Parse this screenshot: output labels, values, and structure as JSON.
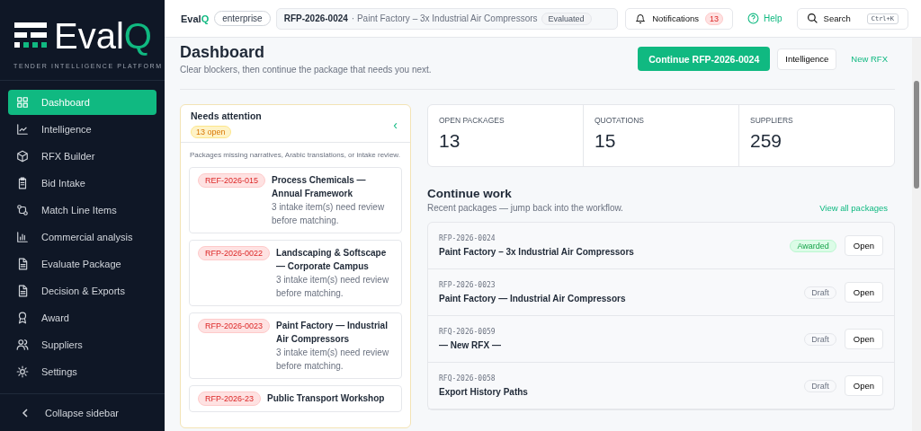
{
  "sidebar": {
    "logo": {
      "text": "Eval",
      "accent": "Q"
    },
    "tagline": "TENDER INTELLIGENCE PLATFORM",
    "items": [
      {
        "label": "Dashboard",
        "selected": true
      },
      {
        "label": "Intelligence",
        "selected": false
      },
      {
        "label": "RFX Builder",
        "selected": false
      },
      {
        "label": "Bid Intake",
        "selected": false
      },
      {
        "label": "Match Line Items",
        "selected": false
      },
      {
        "label": "Commercial analysis",
        "selected": false
      },
      {
        "label": "Evaluate Package",
        "selected": false
      },
      {
        "label": "Decision & Exports",
        "selected": false
      },
      {
        "label": "Award",
        "selected": false
      },
      {
        "label": "Suppliers",
        "selected": false
      },
      {
        "label": "Settings",
        "selected": false
      }
    ],
    "collapse": "Collapse sidebar"
  },
  "topbar": {
    "brand": {
      "text": "Eval",
      "accent": "Q"
    },
    "plan": "enterprise",
    "context": {
      "id": "RFP-2026-0024",
      "title": "· Paint Factory – 3x Industrial Air Compressors",
      "status": "Evaluated"
    },
    "notifications": {
      "label": "Notifications",
      "count": "13"
    },
    "help": "Help",
    "search": {
      "label": "Search",
      "shortcut": "Ctrl+K"
    }
  },
  "header": {
    "title": "Dashboard",
    "subtitle": "Clear blockers, then continue the package that needs you next.",
    "primary": "Continue RFP-2026-0024",
    "secondary": "Intelligence",
    "link": "New RFX"
  },
  "attention": {
    "title": "Needs attention",
    "badge": "13 open",
    "collapse": "‹",
    "note": "Packages missing narratives, Arabic translations, or intake review.",
    "items": [
      {
        "ref": "REF-2026-015",
        "title": "Process Chemicals — Annual Framework",
        "detail": "3 intake item(s) need review before matching."
      },
      {
        "ref": "RFP-2026-0022",
        "title": "Landscaping & Softscape — Corporate Campus",
        "detail": "3 intake item(s) need review before matching."
      },
      {
        "ref": "RFP-2026-0023",
        "title": "Paint Factory — Industrial Air Compressors",
        "detail": "3 intake item(s) need review before matching."
      },
      {
        "ref": "RFP-2026-23",
        "title": "Public Transport Workshop"
      }
    ]
  },
  "stats": [
    {
      "label": "OPEN PACKAGES",
      "value": "13"
    },
    {
      "label": "QUOTATIONS",
      "value": "15"
    },
    {
      "label": "SUPPLIERS",
      "value": "259"
    }
  ],
  "continue_work": {
    "title": "Continue work",
    "subtitle": "Recent packages — jump back into the workflow.",
    "link": "View all packages",
    "rows": [
      {
        "ref": "RFP-2026-0024",
        "title": "Paint Factory – 3x Industrial Air Compressors",
        "status": "Awarded",
        "kind": "awarded",
        "action": "Open"
      },
      {
        "ref": "RFP-2026-0023",
        "title": "Paint Factory — Industrial Air Compressors",
        "status": "Draft",
        "kind": "draft",
        "action": "Open"
      },
      {
        "ref": "RFQ-2026-0059",
        "title": "— New RFX —",
        "status": "Draft",
        "kind": "draft",
        "action": "Open"
      },
      {
        "ref": "RFQ-2026-0058",
        "title": "Export History Paths",
        "status": "Draft",
        "kind": "draft",
        "action": "Open"
      }
    ]
  }
}
